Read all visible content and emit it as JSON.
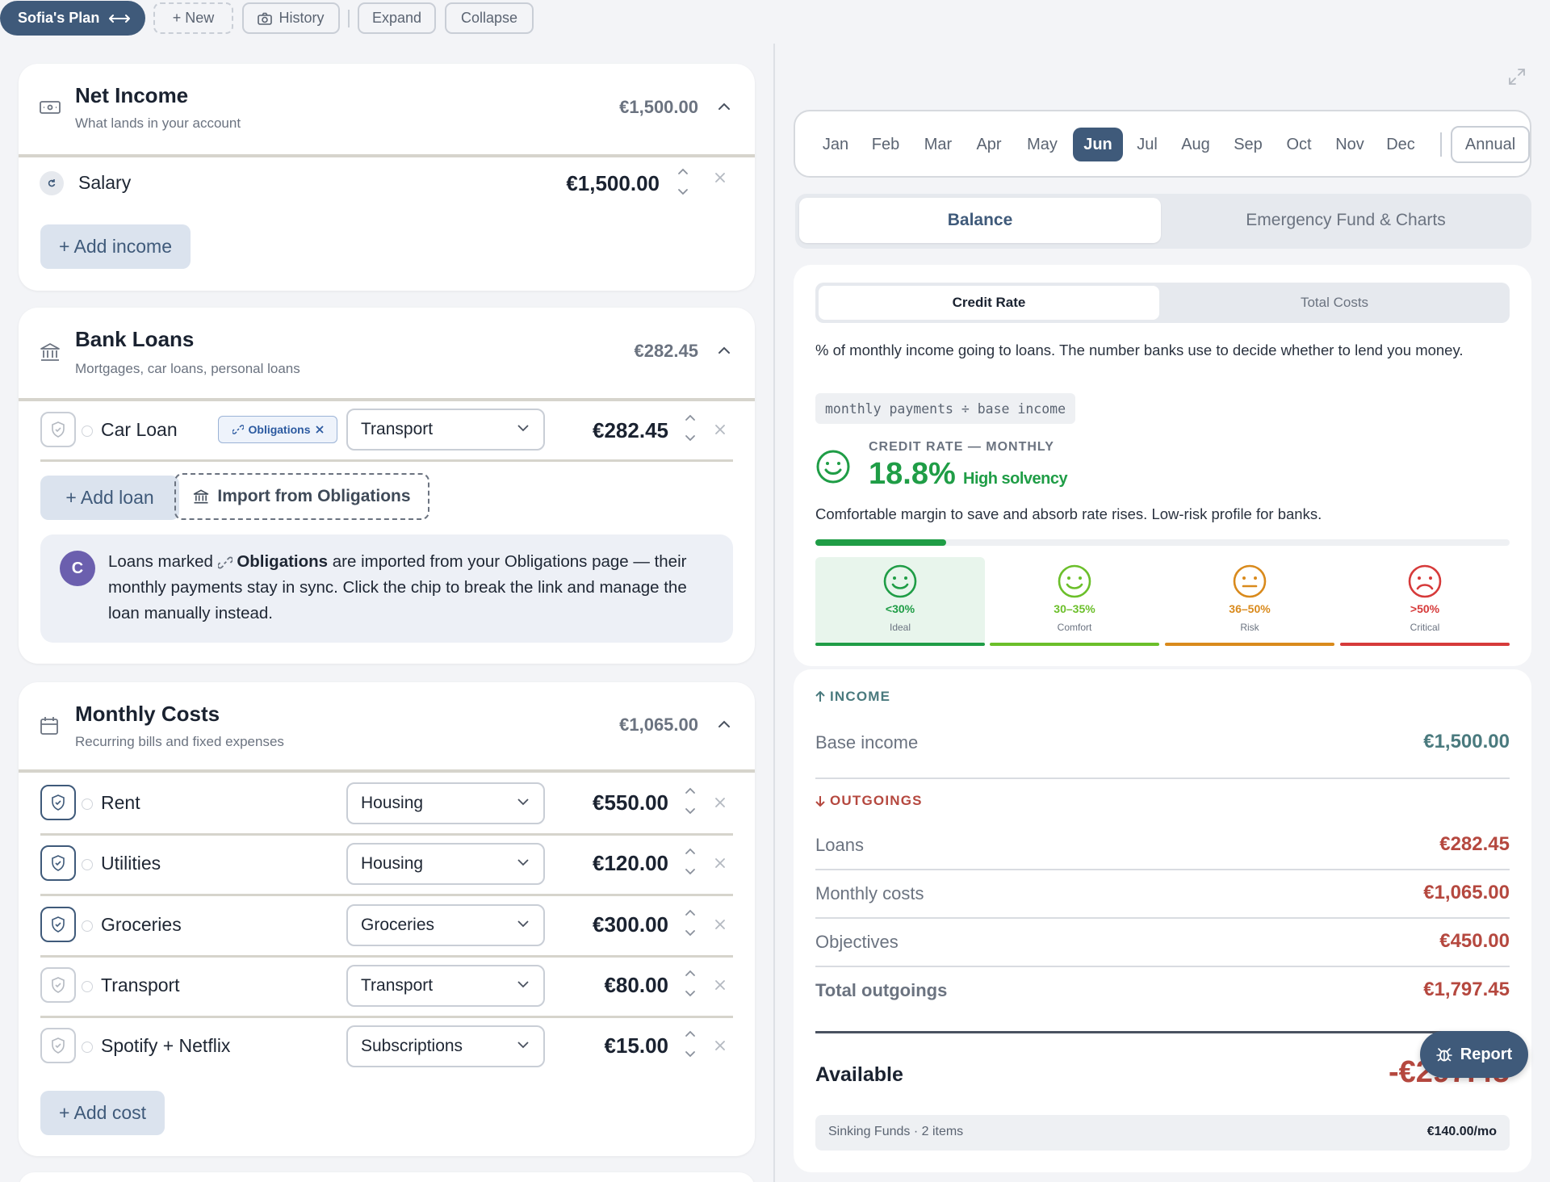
{
  "toolbar": {
    "plan_name": "Sofia's Plan",
    "new_label": "+ New",
    "history_label": "History",
    "expand_label": "Expand",
    "collapse_label": "Collapse"
  },
  "net_income": {
    "title": "Net Income",
    "subtitle": "What lands in your account",
    "total": "€1,500.00",
    "items": [
      {
        "label": "Salary",
        "amount": "€1,500.00"
      }
    ],
    "add_label": "+ Add income"
  },
  "bank_loans": {
    "title": "Bank Loans",
    "subtitle": "Mortgages, car loans, personal loans",
    "total": "€282.45",
    "items": [
      {
        "label": "Car Loan",
        "chip": "Obligations",
        "category": "Transport",
        "amount": "€282.45"
      }
    ],
    "add_label": "+ Add loan",
    "import_label": "Import from Obligations",
    "note": {
      "avatar": "C",
      "before": "Loans marked",
      "bold": "Obligations",
      "after": "are imported from your Obligations page — their monthly payments stay in sync. Click the chip to break the link and manage the loan manually instead."
    }
  },
  "monthly_costs": {
    "title": "Monthly Costs",
    "subtitle": "Recurring bills and fixed expenses",
    "total": "€1,065.00",
    "items": [
      {
        "label": "Rent",
        "category": "Housing",
        "amount": "€550.00",
        "protected": true
      },
      {
        "label": "Utilities",
        "category": "Housing",
        "amount": "€120.00",
        "protected": true
      },
      {
        "label": "Groceries",
        "category": "Groceries",
        "amount": "€300.00",
        "protected": true
      },
      {
        "label": "Transport",
        "category": "Transport",
        "amount": "€80.00",
        "protected": false
      },
      {
        "label": "Spotify + Netflix",
        "category": "Subscriptions",
        "amount": "€15.00",
        "protected": false
      }
    ],
    "add_label": "+ Add cost"
  },
  "months": {
    "items": [
      "Jan",
      "Feb",
      "Mar",
      "Apr",
      "May",
      "Jun",
      "Jul",
      "Aug",
      "Sep",
      "Oct",
      "Nov",
      "Dec"
    ],
    "active": "Jun",
    "annual_label": "Annual"
  },
  "main_tabs": {
    "active": "Balance",
    "inactive": "Emergency Fund & Charts"
  },
  "credit": {
    "tab_active": "Credit Rate",
    "tab_inactive": "Total Costs",
    "description": "% of monthly income going to loans. The number banks use to decide whether to lend you money.",
    "formula": "monthly payments ÷ base income",
    "kicker": "CREDIT RATE — MONTHLY",
    "rate": "18.8%",
    "rate_fraction": 0.188,
    "rating": "High solvency",
    "comment": "Comfortable margin to save and absorb rate rises. Low-risk profile for banks.",
    "bands": [
      {
        "range": "<30%",
        "label": "Ideal",
        "color": "#1f9d46",
        "icon": "smile-icon"
      },
      {
        "range": "30–35%",
        "label": "Comfort",
        "color": "#6bbf2a",
        "icon": "smile-icon"
      },
      {
        "range": "36–50%",
        "label": "Risk",
        "color": "#d98a1c",
        "icon": "neutral-face-icon"
      },
      {
        "range": ">50%",
        "label": "Critical",
        "color": "#d63a3a",
        "icon": "frown-icon"
      }
    ]
  },
  "balance": {
    "income_header": "INCOME",
    "base_income_label": "Base income",
    "base_income_value": "€1,500.00",
    "outgoings_header": "OUTGOINGS",
    "outgoings": [
      {
        "label": "Loans",
        "value": "€282.45"
      },
      {
        "label": "Monthly costs",
        "value": "€1,065.00"
      },
      {
        "label": "Objectives",
        "value": "€450.00"
      }
    ],
    "total_label": "Total outgoings",
    "total_value": "€1,797.45",
    "available_label": "Available",
    "available_value": "-€297.45",
    "sinking_label": "Sinking Funds · 2 items",
    "sinking_value": "€140.00/mo"
  },
  "report_label": "Report",
  "colors": {
    "accent": "#3f5a7a",
    "positive": "#1f9d46",
    "negative": "#b5483f",
    "income": "#4a7a7e"
  }
}
